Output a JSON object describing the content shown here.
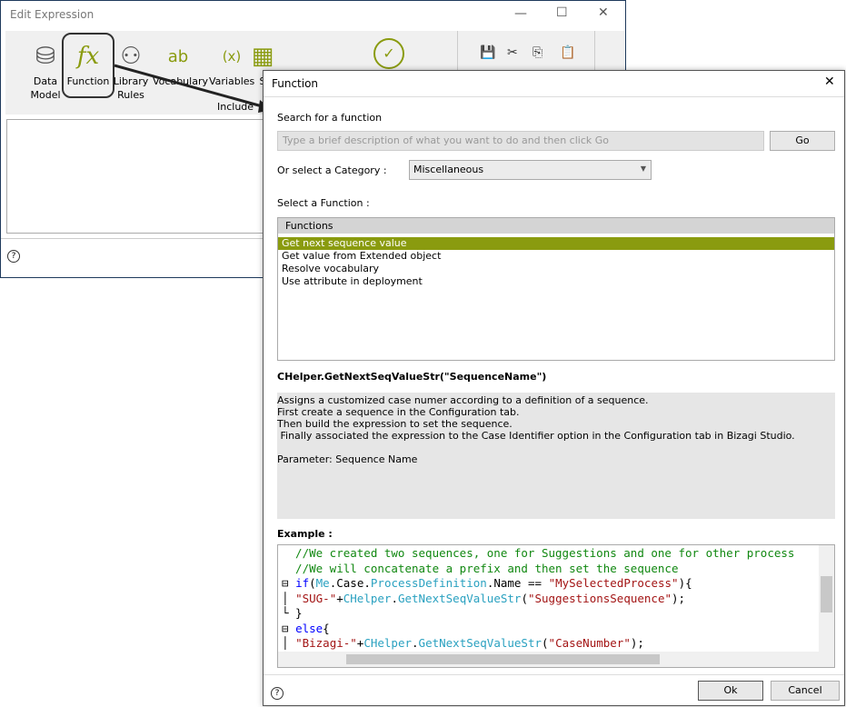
{
  "outer": {
    "title": "Edit Expression",
    "tools": [
      {
        "label": "Data\nModel",
        "icon": "database-icon"
      },
      {
        "label": "Function",
        "icon": "function-icon"
      },
      {
        "label": "Library\nRules",
        "icon": "library-rules-icon"
      },
      {
        "label": "Vocabulary",
        "icon": "vocabulary-icon"
      },
      {
        "label": "Variables",
        "icon": "variables-icon"
      },
      {
        "label": "S",
        "icon": "sheet-icon"
      }
    ],
    "include_label": "Include"
  },
  "dialog": {
    "title": "Function",
    "search_label": "Search for a function",
    "search_placeholder": "Type a brief description of what you want to do and then click Go",
    "go_label": "Go",
    "category_label": "Or select a Category :",
    "category_value": "Miscellaneous",
    "select_label": "Select a Function :",
    "list_header": "Functions",
    "functions": [
      "Get next sequence value",
      "Get value from Extended object",
      "Resolve vocabulary",
      "Use attribute in deployment"
    ],
    "selected_index": 0,
    "signature": "CHelper.GetNextSeqValueStr(\"SequenceName\")",
    "description": [
      "Assigns a customized case numer according to a definition of a sequence.",
      "First create a sequence in the Configuration tab.",
      "Then build the expression to set the sequence.",
      " Finally associated the expression to the Case Identifier option in the Configuration tab in Bizagi Studio.",
      "",
      "Parameter: Sequence Name"
    ],
    "example_label": "Example :",
    "ok_label": "Ok",
    "cancel_label": "Cancel"
  },
  "colors": {
    "accent": "#8a9b0f",
    "selected_text": "#ffffff"
  }
}
